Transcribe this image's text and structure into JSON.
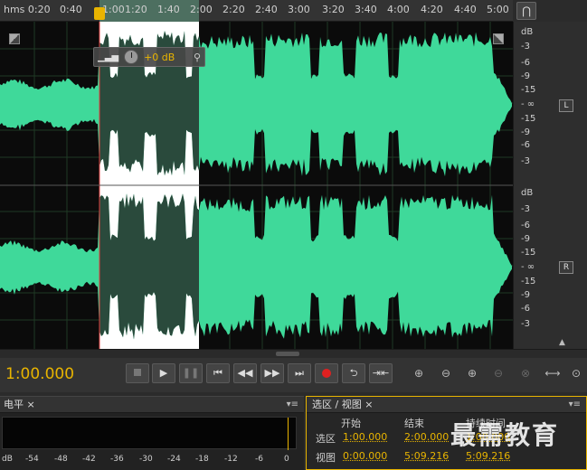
{
  "timeline": {
    "ticks": [
      "hms 0:20",
      "0:40",
      "1:00",
      "1:20",
      "1:40",
      "2:00",
      "2:20",
      "2:40",
      "3:00",
      "3:20",
      "3:40",
      "4:00",
      "4:20",
      "4:40",
      "5:00"
    ],
    "icon": "magnet-snap-icon"
  },
  "hud": {
    "volume": "+0 dB"
  },
  "db_ruler": {
    "labels_top": [
      "dB",
      "-3",
      "-6",
      "-9",
      "-15",
      "- ∞",
      "-15",
      "-9",
      "-6",
      "-3"
    ],
    "labels_bottom": [
      "dB",
      "-3",
      "-6",
      "-9",
      "-15",
      "- ∞",
      "-15",
      "-9",
      "-6",
      "-3"
    ],
    "channel_left": "L",
    "channel_right": "R"
  },
  "transport": {
    "time": "1:00.000",
    "buttons": [
      "stop",
      "play",
      "pause",
      "go-to-start",
      "rewind",
      "fast-forward",
      "go-to-end",
      "record",
      "loop",
      "skip-selection"
    ],
    "zoom_buttons": [
      "zoom-in-amplitude",
      "zoom-out-amplitude",
      "zoom-in-time",
      "zoom-out-time",
      "zoom-out-full",
      "zoom-in-selection",
      "zoom-out-all"
    ]
  },
  "level_panel": {
    "title": "电平 ×",
    "scale": [
      "dB",
      "-54",
      "-48",
      "-42",
      "-36",
      "-30",
      "-24",
      "-18",
      "-12",
      "-6",
      "0"
    ]
  },
  "selection_panel": {
    "title": "选区 / 视图 ×",
    "headers": {
      "start": "开始",
      "end": "结束",
      "duration": "持续时间"
    },
    "rows": [
      {
        "label": "选区",
        "start": "1:00.000",
        "end": "2:00.000",
        "duration": "1:00.000"
      },
      {
        "label": "视图",
        "start": "0:00.000",
        "end": "5:09.216",
        "duration": "5:09.216"
      }
    ]
  },
  "watermark": "最需教育",
  "colors": {
    "wave": "#3fd99a",
    "selection": "#ffffff",
    "accent": "#e8b400"
  }
}
